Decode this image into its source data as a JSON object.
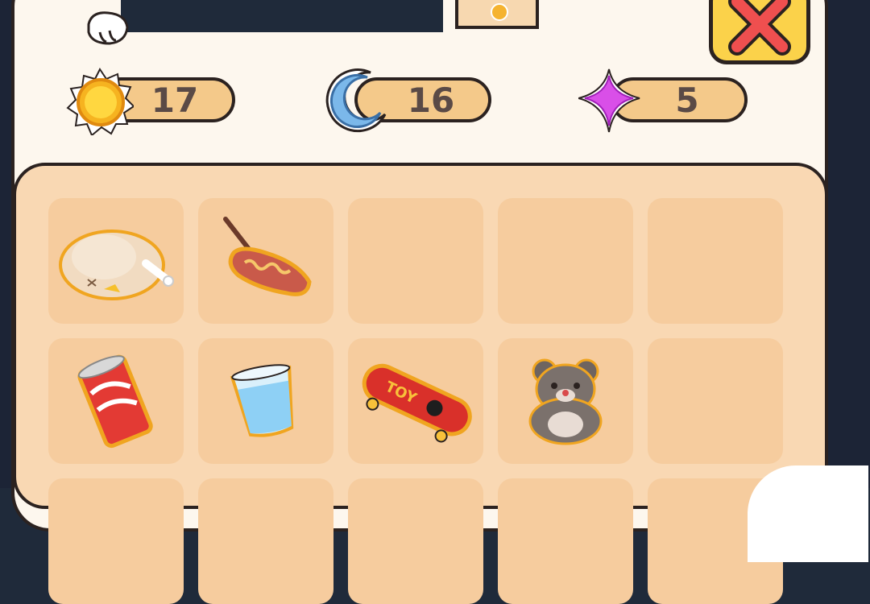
{
  "resources": {
    "sun": {
      "icon": "sun-icon",
      "value": "17"
    },
    "moon": {
      "icon": "moon-icon",
      "value": "16"
    },
    "star": {
      "icon": "star-icon",
      "value": "5"
    }
  },
  "close_button": {
    "icon": "close-icon"
  },
  "inventory": {
    "rows": [
      [
        {
          "item": "roast-chicken-icon"
        },
        {
          "item": "sausage-icon"
        },
        {
          "item": ""
        },
        {
          "item": ""
        },
        {
          "item": ""
        }
      ],
      [
        {
          "item": "soda-can-icon"
        },
        {
          "item": "water-glass-icon"
        },
        {
          "item": "skateboard-icon",
          "label": "TOY"
        },
        {
          "item": "teddy-bear-icon"
        },
        {
          "item": ""
        }
      ]
    ]
  },
  "colors": {
    "panel": "#fdf7ee",
    "grid_bg": "#f9d8b3",
    "slot": "#f6cc9e",
    "pill": "#f4c98a",
    "close": "#fbd24a",
    "close_x": "#ef4f4f",
    "outline": "#2b2220",
    "text": "#5a4a46"
  }
}
